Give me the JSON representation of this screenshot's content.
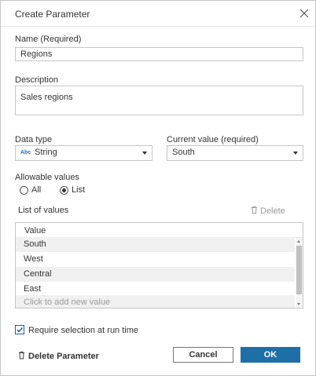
{
  "dialog": {
    "title": "Create Parameter",
    "close_icon": "close-icon"
  },
  "name": {
    "label": "Name (Required)",
    "value": "Regions"
  },
  "description": {
    "label": "Description",
    "value": "Sales regions"
  },
  "data_type": {
    "label": "Data type",
    "type_badge": "Abc",
    "value": "String"
  },
  "current_value": {
    "label": "Current value (required)",
    "value": "South"
  },
  "allowable_values": {
    "label": "Allowable values",
    "options": [
      {
        "label": "All",
        "selected": false
      },
      {
        "label": "List",
        "selected": true
      }
    ]
  },
  "list_of_values": {
    "label": "List of values",
    "delete_label": "Delete",
    "column_header": "Value",
    "rows": [
      "South",
      "West",
      "Central",
      "East"
    ],
    "add_placeholder": "Click to add new value"
  },
  "require_selection": {
    "label": "Require selection at run time",
    "checked": true
  },
  "footer": {
    "delete_parameter_label": "Delete Parameter",
    "cancel_label": "Cancel",
    "ok_label": "OK"
  },
  "colors": {
    "accent": "#1e6fa8",
    "border": "#c6c6c6",
    "disabled_text": "#9a9a9a"
  }
}
